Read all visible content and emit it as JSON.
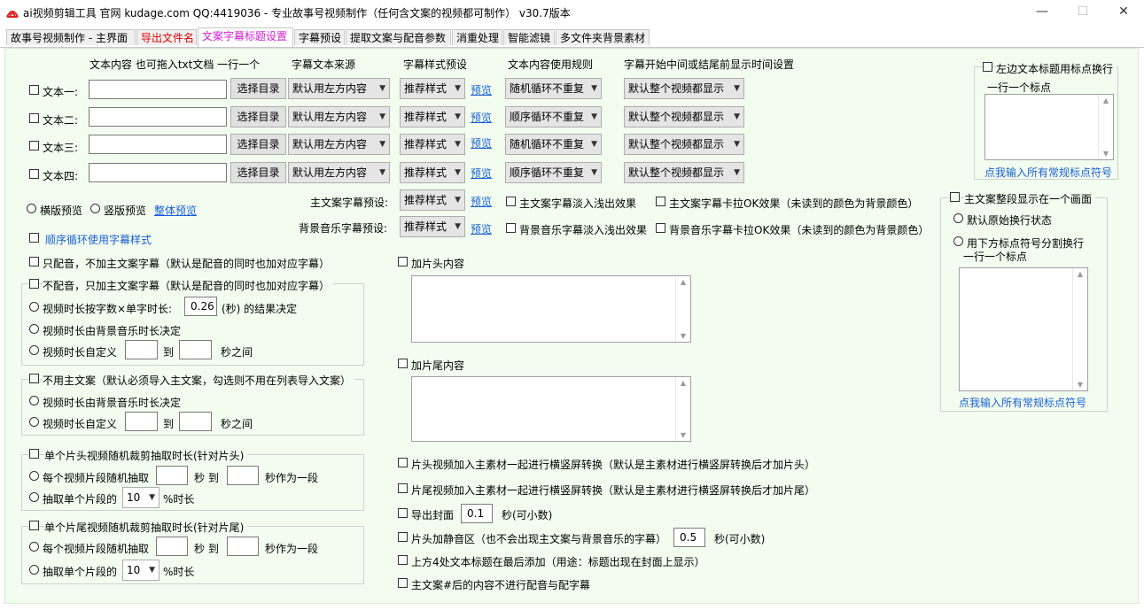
{
  "window": {
    "title": "ai视频剪辑工具 官网 kudage.com QQ:4419036 -  专业故事号视频制作（任何含文案的视频都可制作）  v30.7版本",
    "minimize": "—",
    "maximize": "☐",
    "close": "✕"
  },
  "tabs": [
    {
      "label": "故事号视频制作 - 主界面"
    },
    {
      "label": "导出文件名"
    },
    {
      "label": "文案字幕标题设置"
    },
    {
      "label": "字幕预设"
    },
    {
      "label": "提取文案与配音参数"
    },
    {
      "label": "消重处理"
    },
    {
      "label": "智能滤镜"
    },
    {
      "label": "多文件夹背景素材"
    }
  ],
  "headers": {
    "text_content": "文本内容 也可拖入txt文档 一行一个",
    "subtitle_source": "字幕文本来源",
    "style_preset": "字幕样式预设",
    "usage_rule": "文本内容使用规则",
    "display_time": "字幕开始中间或结尾前显示时间设置"
  },
  "text_rows": [
    {
      "label": "文本一:",
      "value": "",
      "button": "选择目录",
      "source": "默认用左方内容",
      "style": "推荐样式",
      "preview": "预览",
      "rule": "随机循环不重复",
      "time": "默认整个视频都显示"
    },
    {
      "label": "文本二:",
      "value": "",
      "button": "选择目录",
      "source": "默认用左方内容",
      "style": "推荐样式",
      "preview": "预览",
      "rule": "顺序循环不重复",
      "time": "默认整个视频都显示"
    },
    {
      "label": "文本三:",
      "value": "",
      "button": "选择目录",
      "source": "默认用左方内容",
      "style": "推荐样式",
      "preview": "预览",
      "rule": "随机循环不重复",
      "time": "默认整个视频都显示"
    },
    {
      "label": "文本四:",
      "value": "",
      "button": "选择目录",
      "source": "默认用左方内容",
      "style": "推荐样式",
      "preview": "预览",
      "rule": "顺序循环不重复",
      "time": "默认整个视频都显示"
    }
  ],
  "preview_mode": {
    "horizontal": "横版预览",
    "vertical": "竖版预览",
    "overall": "整体预览"
  },
  "seq_loop_style": "顺序循环使用字幕样式",
  "main_preset": {
    "label": "主文案字幕预设:",
    "value": "推荐样式",
    "preview": "预览",
    "fade": "主文案字幕淡入浅出效果",
    "karaoke": "主文案字幕卡拉OK效果（未读到的颜色为背景颜色）"
  },
  "bgm_preset": {
    "label": "背景音乐字幕预设:",
    "value": "推荐样式",
    "preview": "预览",
    "fade": "背景音乐字幕淡入浅出效果",
    "karaoke": "背景音乐字幕卡拉OK效果（未读到的颜色为背景颜色）"
  },
  "left": {
    "only_dub": "只配音，不加主文案字幕（默认是配音的同时也加对应字幕）",
    "no_dub": "不配音，只加主文案字幕（默认是配音的同时也加对应字幕）",
    "duration_by_chars": "视频时长按字数×单字时长:",
    "char_duration": "0.26",
    "duration_by_chars_suffix": "(秒) 的结果决定",
    "duration_by_bgm": "视频时长由背景音乐时长决定",
    "duration_custom": "视频时长自定义",
    "to": "到",
    "between_sec": "秒之间",
    "no_main_text": "不用主文案（默认必须导入主文案，勾选则不用在列表导入文案）",
    "head_clip": "单个片头视频随机裁剪抽取时长(针对片头)",
    "tail_clip": "单个片尾视频随机裁剪抽取时长(针对片尾)",
    "each_random": "每个视频片段随机抽取",
    "sec": "秒",
    "sec_as_segment": "秒作为一段",
    "extract_pct": "抽取单个片段的",
    "pct_value": "10",
    "pct_suffix": "%时长"
  },
  "middle": {
    "intro_content": "加片头内容",
    "outro_content": "加片尾内容",
    "intro_convert": "片头视频加入主素材一起进行横竖屏转换（默认是主素材进行横竖屏转换后才加片头）",
    "outro_convert": "片尾视频加入主素材一起进行横竖屏转换（默认是主素材进行横竖屏转换后才加片尾）",
    "export_cover": "导出封面",
    "cover_value": "0.1",
    "cover_suffix": "秒(可小数)",
    "intro_silence": "片头加静音区（也不会出现主文案与背景音乐的字幕）",
    "silence_value": "0.5",
    "silence_suffix": "秒(可小数)",
    "title_last": "上方4处文本标题在最后添加（用途：标题出现在封面上显示）",
    "no_dub_after_hash": "主文案#后的内容不进行配音与配字幕"
  },
  "right": {
    "left_title_wrap": "左边文本标题用标点换行",
    "one_per_line": "一行一个标点",
    "input_punct_link": "点我输入所有常规标点符号",
    "one_screen": "主文案整段显示在一个画面",
    "default_wrap": "默认原始换行状态",
    "punct_wrap": "用下方标点符号分割换行",
    "one_per_line2": "一行一个标点",
    "input_punct_link2": "点我输入所有常规标点符号"
  },
  "colors": {
    "accent": "#d11fd1",
    "link": "#1a5fd6",
    "panel_bg": "#f2fdf0",
    "red_tab": "#e00000"
  }
}
